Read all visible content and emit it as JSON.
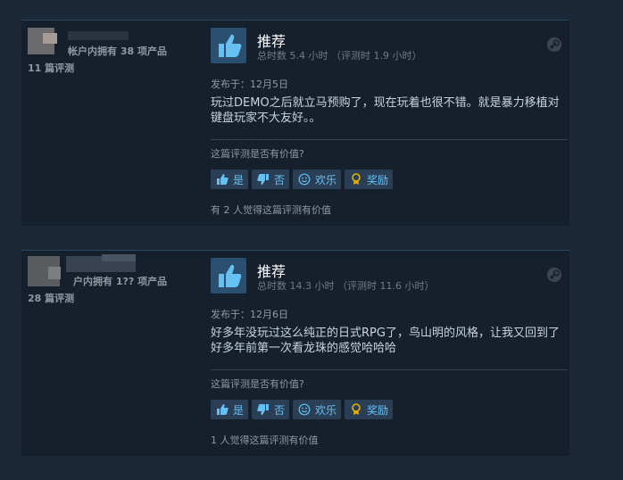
{
  "reviews": [
    {
      "author": {
        "owned": "帐户内拥有 38 项产品",
        "review_count": "11 篇评测"
      },
      "verdict": "推荐",
      "hours": "总时数 5.4 小时 （评测时 1.9 小时）",
      "posted": "发布于：12月5日",
      "body": "玩过DEMO之后就立马预购了，现在玩着也很不错。就是暴力移植对键盘玩家不大友好。。",
      "helpful_question": "这篇评测是否有价值?",
      "buttons": {
        "yes": "是",
        "no": "否",
        "funny": "欢乐",
        "award": "奖励"
      },
      "helpful_count": "有 2 人觉得这篇评测有价值"
    },
    {
      "author": {
        "owned": "户内拥有 1?? 项产品",
        "review_count": "28 篇评测"
      },
      "verdict": "推荐",
      "hours": "总时数 14.3 小时 （评测时 11.6 小时）",
      "posted": "发布于：12月6日",
      "body": "好多年没玩过这么纯正的日式RPG了，鸟山明的风格，让我又回到了好多年前第一次看龙珠的感觉哈哈哈",
      "helpful_question": "这篇评测是否有价值?",
      "buttons": {
        "yes": "是",
        "no": "否",
        "funny": "欢乐",
        "award": "奖励"
      },
      "helpful_count": "1 人觉得这篇评测有价值"
    }
  ],
  "colors": {
    "background": "#1b2838",
    "panel": "#16202d",
    "accent": "#66c0f4",
    "button": "#2a3f55"
  },
  "icons": [
    "thumbs-up-icon",
    "thumbs-down-icon",
    "smiley-icon",
    "award-icon",
    "steam-icon",
    "avatar"
  ]
}
